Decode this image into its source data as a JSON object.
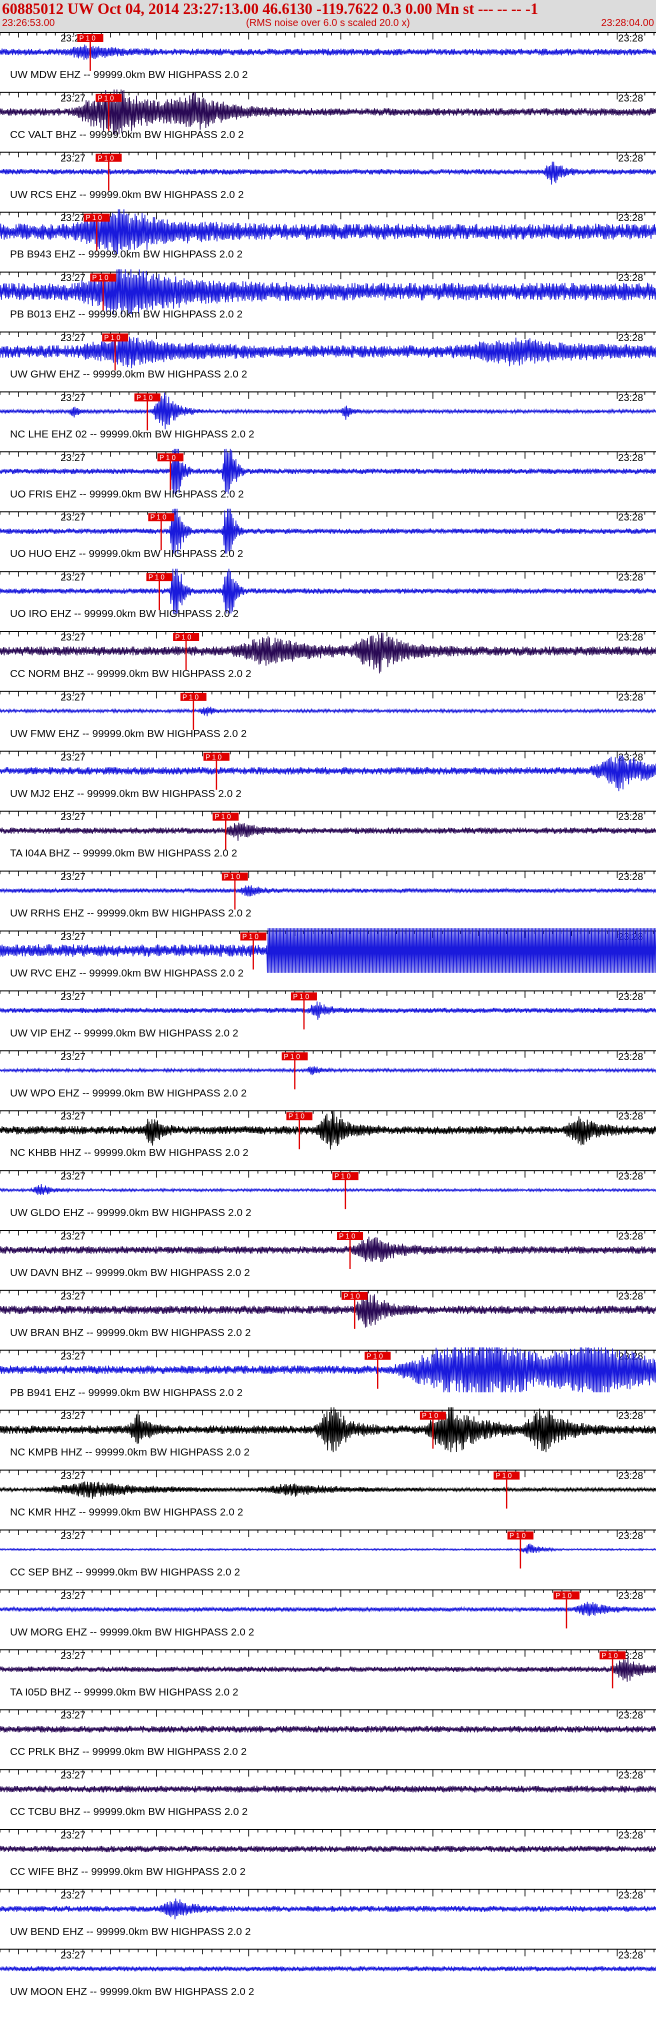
{
  "header": {
    "title": "60885012 UW Oct 04, 2014 23:27:13.00   46.6130 -119.7622  0.3 0.00 Mn st --- -- --  -1",
    "start_time": "23:26:53.00",
    "noise_note": "(RMS noise over 6.0 s scaled 20.0 x)",
    "end_time": "23:28:04.00"
  },
  "colors": {
    "accent": "#cc0000",
    "blue_trace": "#1a1adc",
    "dark_trace": "#2a0a55",
    "black_trace": "#000000",
    "header_bg": "#dcdcdc"
  },
  "chart_data": {
    "type": "line",
    "title": "60885012 UW Oct 04, 2014 23:27:13.00   46.6130 -119.7622  0.3 0.00 Mn st --- -- --  -1",
    "x_range": [
      "23:26:53.00",
      "23:28:04.00"
    ],
    "x_range_seconds": [
      0,
      71
    ],
    "tick_labels": [
      "23:27",
      "23:28"
    ],
    "pick_label": "P 1.0",
    "channel_suffix": " -- 99999.0km BW  HIGHPASS  2.0  2",
    "series": [
      {
        "name": "UW MDW EHZ",
        "color": "blue",
        "pick_s": 9.8,
        "amp": 0.16,
        "events": [
          [
            9.5,
            2.0,
            0.35
          ]
        ],
        "clip": false
      },
      {
        "name": "CC VALT BHZ",
        "color": "dark",
        "pick_s": 11.8,
        "amp": 0.18,
        "events": [
          [
            12.5,
            4.0,
            1.3
          ],
          [
            21.0,
            3.0,
            0.8
          ]
        ],
        "clip": false
      },
      {
        "name": "UW RCS EHZ",
        "color": "blue",
        "pick_s": 11.8,
        "amp": 0.13,
        "events": [
          [
            60.0,
            0.8,
            0.7
          ]
        ],
        "clip": false
      },
      {
        "name": "PB B943 EHZ",
        "color": "blue",
        "pick_s": 10.5,
        "amp": 0.38,
        "events": [
          [
            13.0,
            4.5,
            1.0
          ]
        ],
        "clip": false
      },
      {
        "name": "PB B013 EHZ",
        "color": "blue",
        "pick_s": 11.2,
        "amp": 0.42,
        "events": [
          [
            14.0,
            5.0,
            1.1
          ]
        ],
        "clip": false
      },
      {
        "name": "UW GHW EHZ",
        "color": "blue",
        "pick_s": 12.5,
        "amp": 0.3,
        "events": [
          [
            14.0,
            5.0,
            0.6
          ],
          [
            56.0,
            6.0,
            0.5
          ]
        ],
        "clip": false
      },
      {
        "name": "NC LHE EHZ 02",
        "color": "blue",
        "pick_s": 16.0,
        "amp": 0.08,
        "events": [
          [
            17.8,
            1.2,
            1.0
          ],
          [
            8.0,
            0.5,
            0.3
          ],
          [
            37.5,
            0.5,
            0.4
          ]
        ],
        "clip": false
      },
      {
        "name": "UO FRIS EHZ",
        "color": "blue",
        "pick_s": 18.5,
        "amp": 0.13,
        "events": [
          [
            19.0,
            0.5,
            2.6
          ],
          [
            24.7,
            0.5,
            2.6
          ]
        ],
        "clip": false
      },
      {
        "name": "UO HUO EHZ",
        "color": "blue",
        "pick_s": 17.5,
        "amp": 0.13,
        "events": [
          [
            19.0,
            0.5,
            2.6
          ],
          [
            24.7,
            0.5,
            2.6
          ]
        ],
        "clip": false
      },
      {
        "name": "UO IRO EHZ",
        "color": "blue",
        "pick_s": 17.3,
        "amp": 0.13,
        "events": [
          [
            19.0,
            0.5,
            2.6
          ],
          [
            24.7,
            0.5,
            2.6
          ]
        ],
        "clip": false
      },
      {
        "name": "CC NORM BHZ",
        "color": "dark",
        "pick_s": 20.2,
        "amp": 0.22,
        "events": [
          [
            29.0,
            3.5,
            0.7
          ],
          [
            41.0,
            2.5,
            1.0
          ]
        ],
        "clip": false
      },
      {
        "name": "UW FMW EHZ",
        "color": "blue",
        "pick_s": 21.0,
        "amp": 0.07,
        "events": [
          [
            22.4,
            0.6,
            0.3
          ]
        ],
        "clip": false
      },
      {
        "name": "UW MJ2 EHZ",
        "color": "blue",
        "pick_s": 23.5,
        "amp": 0.18,
        "events": [
          [
            67.0,
            2.5,
            1.0
          ]
        ],
        "clip": false
      },
      {
        "name": "TA I04A BHZ",
        "color": "dark",
        "pick_s": 24.5,
        "amp": 0.15,
        "events": [
          [
            26.0,
            1.5,
            0.4
          ]
        ],
        "clip": false
      },
      {
        "name": "UW RRHS EHZ",
        "color": "blue",
        "pick_s": 25.5,
        "amp": 0.1,
        "events": [
          [
            27.0,
            1.0,
            0.3
          ]
        ],
        "clip": false
      },
      {
        "name": "UW RVC EHZ",
        "color": "blue",
        "pick_s": 27.5,
        "amp": 0.3,
        "events": [],
        "clip": true,
        "clip_start_s": 29.0
      },
      {
        "name": "UW VIP EHZ",
        "color": "blue",
        "pick_s": 33.0,
        "amp": 0.12,
        "events": [
          [
            34.5,
            1.0,
            0.4
          ]
        ],
        "clip": false
      },
      {
        "name": "UW WPO EHZ",
        "color": "blue",
        "pick_s": 32.0,
        "amp": 0.07,
        "events": [
          [
            34.0,
            0.6,
            0.3
          ]
        ],
        "clip": false
      },
      {
        "name": "NC KHBB HHZ",
        "color": "black",
        "pick_s": 32.5,
        "amp": 0.2,
        "events": [
          [
            16.5,
            0.8,
            0.8
          ],
          [
            36.0,
            1.5,
            1.0
          ],
          [
            63.0,
            1.5,
            0.7
          ]
        ],
        "clip": false
      },
      {
        "name": "UW GLDO EHZ",
        "color": "blue",
        "pick_s": 37.5,
        "amp": 0.06,
        "events": [
          [
            4.5,
            1.0,
            0.3
          ]
        ],
        "clip": false
      },
      {
        "name": "UW DAVN BHZ",
        "color": "dark",
        "pick_s": 38.0,
        "amp": 0.18,
        "events": [
          [
            40.5,
            2.0,
            0.7
          ]
        ],
        "clip": false
      },
      {
        "name": "UW BRAN BHZ",
        "color": "dark",
        "pick_s": 38.5,
        "amp": 0.2,
        "events": [
          [
            40.0,
            1.5,
            0.9
          ]
        ],
        "clip": false
      },
      {
        "name": "PB B941 EHZ",
        "color": "blue",
        "pick_s": 41.0,
        "amp": 0.2,
        "events": [
          [
            52.0,
            8.0,
            1.8
          ],
          [
            65.0,
            5.0,
            1.2
          ]
        ],
        "clip": false
      },
      {
        "name": "NC KMPB HHZ",
        "color": "black",
        "pick_s": 47.0,
        "amp": 0.2,
        "events": [
          [
            36.0,
            1.5,
            1.3
          ],
          [
            49.0,
            2.5,
            1.4
          ],
          [
            59.0,
            2.0,
            1.2
          ],
          [
            15.0,
            1.0,
            0.8
          ]
        ],
        "clip": false
      },
      {
        "name": "NC KMR HHZ",
        "color": "black",
        "pick_s": 55.0,
        "amp": 0.08,
        "events": [
          [
            10.0,
            5.0,
            0.4
          ],
          [
            32.0,
            4.0,
            0.3
          ]
        ],
        "clip": false
      },
      {
        "name": "CC SEP BHZ",
        "color": "blue",
        "pick_s": 56.5,
        "amp": 0.04,
        "events": [
          [
            57.5,
            1.0,
            0.3
          ]
        ],
        "clip": false
      },
      {
        "name": "UW MORG EHZ",
        "color": "blue",
        "pick_s": 61.5,
        "amp": 0.1,
        "events": [
          [
            64.0,
            1.5,
            0.4
          ]
        ],
        "clip": false
      },
      {
        "name": "TA I05D BHZ",
        "color": "dark",
        "pick_s": 66.5,
        "amp": 0.13,
        "events": [
          [
            68.0,
            1.5,
            0.6
          ]
        ],
        "clip": false
      },
      {
        "name": "CC PRLK BHZ",
        "color": "dark",
        "pick_s": null,
        "amp": 0.16,
        "events": [],
        "clip": false
      },
      {
        "name": "CC TCBU BHZ",
        "color": "dark",
        "pick_s": null,
        "amp": 0.16,
        "events": [],
        "clip": false
      },
      {
        "name": "CC WIFE BHZ",
        "color": "dark",
        "pick_s": null,
        "amp": 0.15,
        "events": [],
        "clip": false
      },
      {
        "name": "UW BEND EHZ",
        "color": "blue",
        "pick_s": null,
        "amp": 0.14,
        "events": [
          [
            19.0,
            1.5,
            0.5
          ]
        ],
        "clip": false
      },
      {
        "name": "UW MOON EHZ",
        "color": "blue",
        "pick_s": null,
        "amp": 0.12,
        "events": [],
        "clip": false
      }
    ]
  }
}
